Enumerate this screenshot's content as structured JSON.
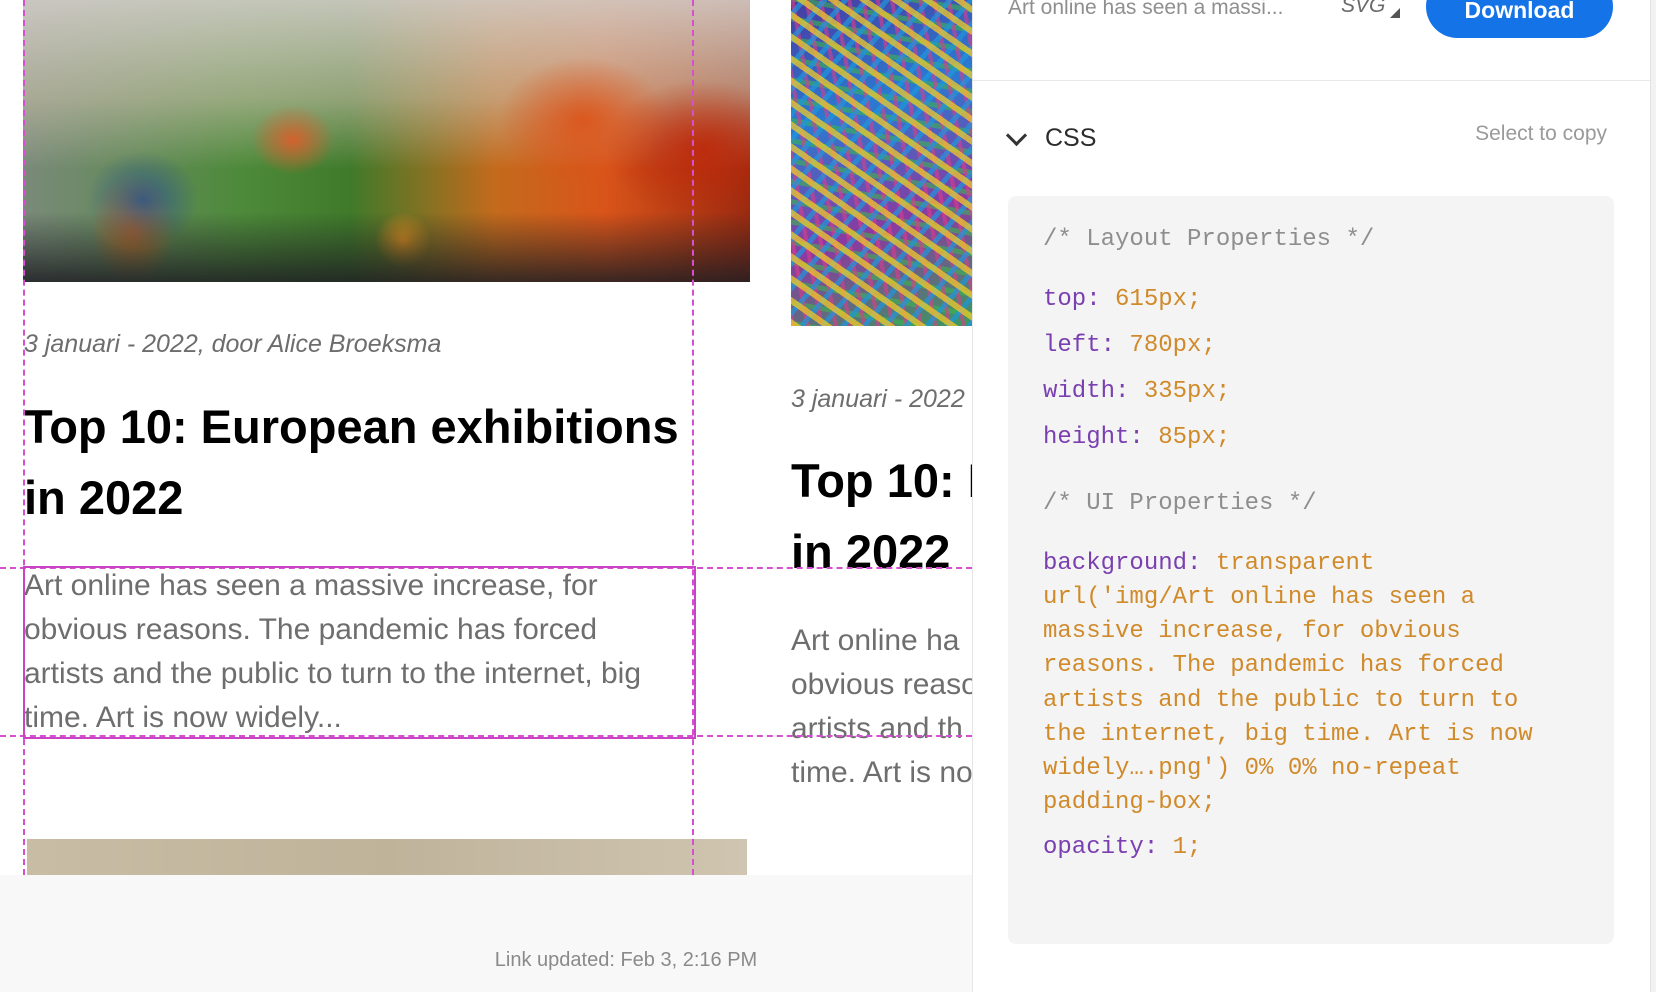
{
  "canvas": {
    "card1": {
      "meta": "3 januari - 2022, door Alice Broeksma",
      "title_line1": "Top 10: European exhibitions",
      "title_line2": "in 2022",
      "excerpt_lines": [
        "Art online has seen a massive increase, for",
        "obvious reasons. The pandemic has forced",
        "artists and the public to turn to the internet, big",
        "time. Art is now widely..."
      ]
    },
    "card2": {
      "meta": "3 januari - 2022",
      "title_line1": "Top 10: E",
      "title_line2": "in 2022",
      "excerpt_lines": [
        "Art online ha",
        "obvious reaso",
        "artists and th",
        "time. Art is no"
      ]
    }
  },
  "footer": {
    "link_updated": "Link updated: Feb 3, 2:16 PM"
  },
  "panel": {
    "asset_name": "Art online has seen a massi...",
    "format": "SVG",
    "download_label": "Download",
    "section_title": "CSS",
    "select_to_copy": "Select to copy",
    "code": {
      "layout_comment": "/* Layout Properties */",
      "top_prop": "top:",
      "top_val": "615px;",
      "left_prop": "left:",
      "left_val": "780px;",
      "width_prop": "width:",
      "width_val": "335px;",
      "height_prop": "height:",
      "height_val": "85px;",
      "ui_comment": "/* UI Properties */",
      "background_prop": "background:",
      "background_val_lines": [
        "transparent",
        "url('img/Art online has seen a",
        "massive increase, for obvious",
        "reasons. The pandemic has forced",
        "artists and the public to turn to",
        "the internet, big time. Art is now",
        "widely….png') 0% 0% no-repeat",
        "padding-box;"
      ],
      "opacity_prop": "opacity:",
      "opacity_val": "1;"
    }
  },
  "colors": {
    "accent": "#1473e6",
    "guide": "#d64fd0",
    "code_property": "#7a3fb0",
    "code_value": "#d08a2a",
    "code_comment": "#8e8e8e"
  },
  "icons": {
    "chevron": "chevron-down-icon",
    "format_caret": "dropdown-triangle-icon"
  }
}
